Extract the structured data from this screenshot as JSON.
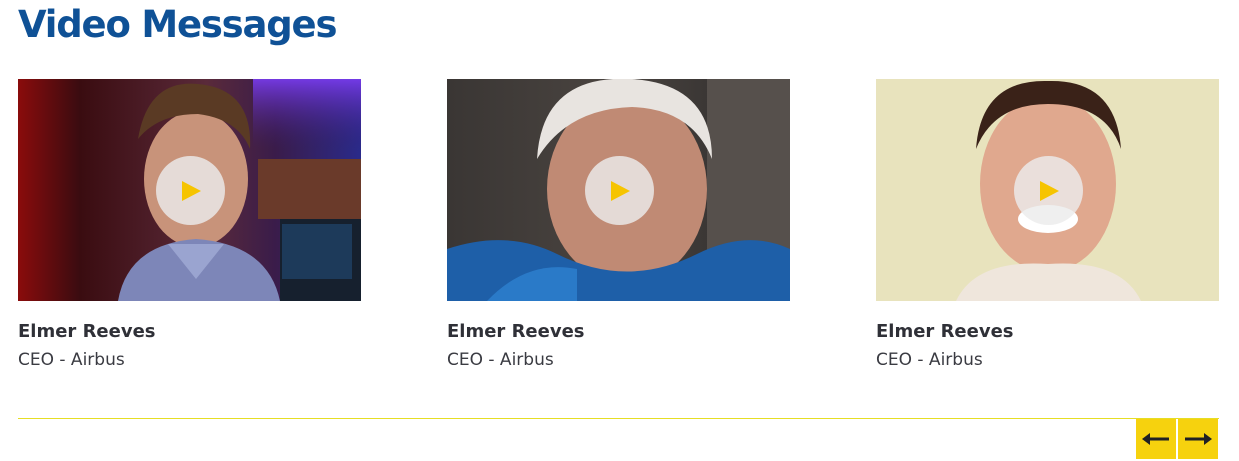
{
  "section": {
    "title": "Video Messages"
  },
  "cards": [
    {
      "name": "Elmer Reeves",
      "role": "CEO - Airbus"
    },
    {
      "name": "Elmer Reeves",
      "role": "CEO - Airbus"
    },
    {
      "name": "Elmer Reeves",
      "role": "CEO - Airbus"
    }
  ],
  "icons": {
    "play": "play-icon",
    "prev": "arrow-left-icon",
    "next": "arrow-right-icon"
  },
  "colors": {
    "title": "#0f5196",
    "accent": "#f6d20e",
    "text": "#2f3037"
  }
}
